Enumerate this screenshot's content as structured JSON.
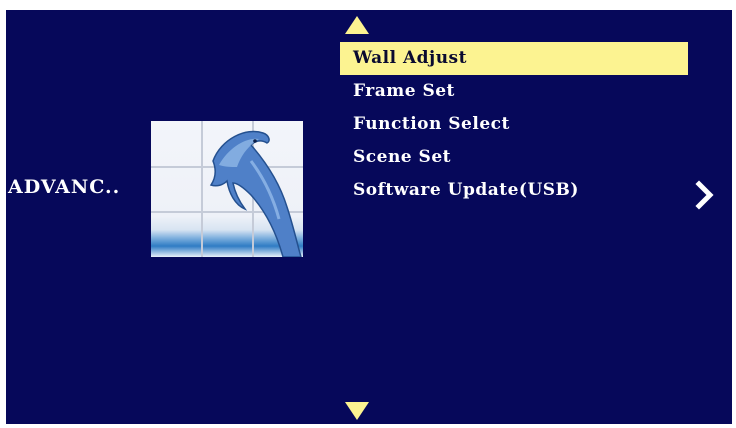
{
  "category": {
    "label": "ADVANC.."
  },
  "thumbnail": {
    "icon": "dolphin-image-icon"
  },
  "menu": {
    "items": [
      {
        "label": "Wall Adjust",
        "selected": true
      },
      {
        "label": "Frame Set",
        "selected": false
      },
      {
        "label": "Function Select",
        "selected": false
      },
      {
        "label": "Scene Set",
        "selected": false
      },
      {
        "label": "Software Update(USB)",
        "selected": false
      }
    ]
  },
  "navigation": {
    "up_icon": "triangle-up-icon",
    "down_icon": "triangle-down-icon",
    "next_icon": "chevron-right-icon"
  },
  "colors": {
    "background": "#06085a",
    "highlight": "#fcf391",
    "text": "#ffffff"
  }
}
